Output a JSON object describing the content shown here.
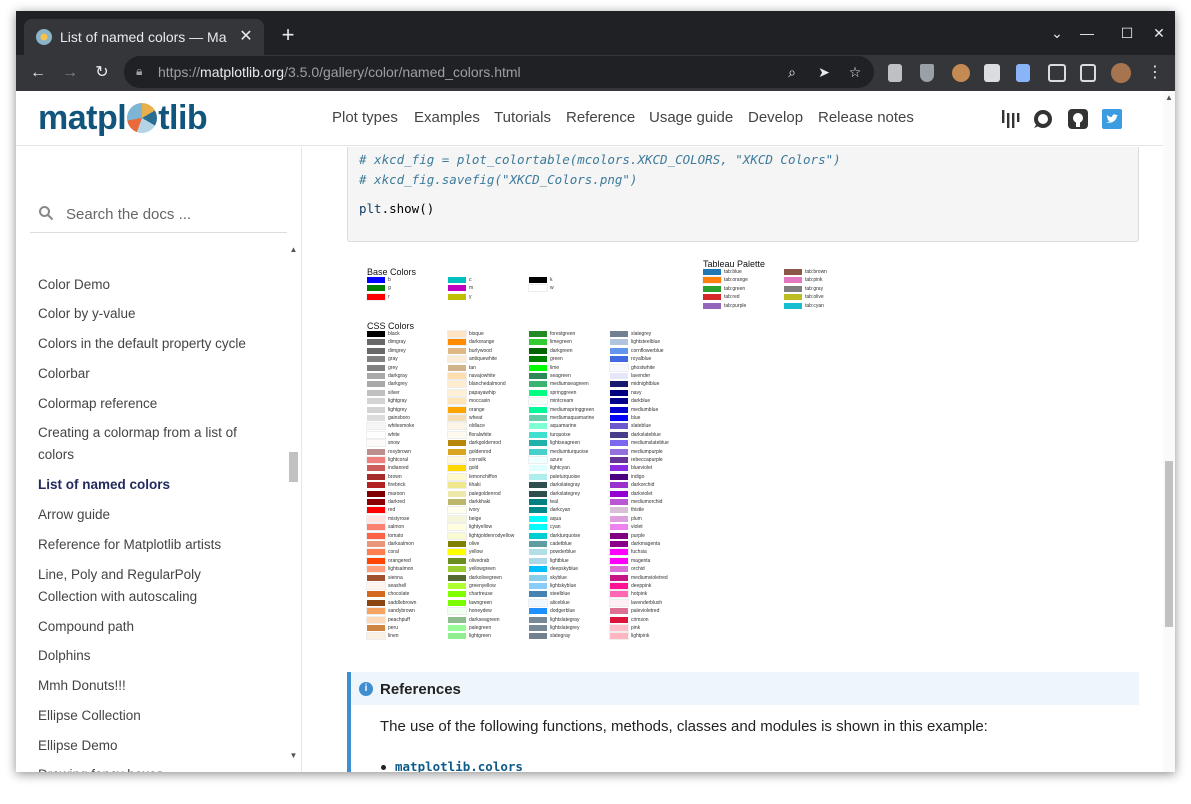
{
  "browser": {
    "tab_title": "List of named colors — Ma",
    "url_prefix": "https://",
    "url_host": "matplotlib.org",
    "url_path": "/3.5.0/gallery/color/named_colors.html"
  },
  "header": {
    "logo": "matplotlib",
    "nav": [
      "Plot types",
      "Examples",
      "Tutorials",
      "Reference",
      "Usage guide",
      "Develop",
      "Release notes"
    ]
  },
  "sidebar": {
    "search_placeholder": "Search the docs ...",
    "items": [
      {
        "label": "Color Demo"
      },
      {
        "label": "Color by y-value"
      },
      {
        "label": "Colors in the default property cycle"
      },
      {
        "label": "Colorbar"
      },
      {
        "label": "Colormap reference"
      },
      {
        "label": "Creating a colormap from a list of colors"
      },
      {
        "label": "List of named colors",
        "active": true
      },
      {
        "label": "Arrow guide"
      },
      {
        "label": "Reference for Matplotlib artists"
      },
      {
        "label": "Line, Poly and RegularPoly Collection with autoscaling"
      },
      {
        "label": "Compound path"
      },
      {
        "label": "Dolphins"
      },
      {
        "label": "Mmh Donuts!!!"
      },
      {
        "label": "Ellipse Collection"
      },
      {
        "label": "Ellipse Demo"
      },
      {
        "label": "Drawing fancy boxes"
      }
    ]
  },
  "code": {
    "line1": "# xkcd_fig = plot_colortable(mcolors.XKCD_COLORS, \"XKCD Colors\")",
    "line2": "# xkcd_fig.savefig(\"XKCD_Colors.png\")",
    "line3_obj": "plt",
    "line3_fn": ".show()"
  },
  "figure": {
    "base_title": "Base Colors",
    "tableau_title": "Tableau Palette",
    "css_title": "CSS Colors",
    "base": [
      [
        [
          "b",
          "#0000ff"
        ],
        [
          "g",
          "#008000"
        ],
        [
          "r",
          "#ff0000"
        ]
      ],
      [
        [
          "c",
          "#00bfbf"
        ],
        [
          "m",
          "#bf00bf"
        ],
        [
          "y",
          "#bfbf00"
        ]
      ],
      [
        [
          "k",
          "#000000"
        ],
        [
          "w",
          "#ffffff"
        ]
      ]
    ],
    "tableau": [
      [
        [
          "tab:blue",
          "#1f77b4"
        ],
        [
          "tab:orange",
          "#ff7f0e"
        ],
        [
          "tab:green",
          "#2ca02c"
        ],
        [
          "tab:red",
          "#d62728"
        ],
        [
          "tab:purple",
          "#9467bd"
        ]
      ],
      [
        [
          "tab:brown",
          "#8c564b"
        ],
        [
          "tab:pink",
          "#e377c2"
        ],
        [
          "tab:gray",
          "#7f7f7f"
        ],
        [
          "tab:olive",
          "#bcbd22"
        ],
        [
          "tab:cyan",
          "#17becf"
        ]
      ]
    ],
    "css": [
      [
        [
          "black",
          "#000000"
        ],
        [
          "dimgray",
          "#696969"
        ],
        [
          "dimgrey",
          "#696969"
        ],
        [
          "gray",
          "#808080"
        ],
        [
          "grey",
          "#808080"
        ],
        [
          "darkgray",
          "#a9a9a9"
        ],
        [
          "darkgrey",
          "#a9a9a9"
        ],
        [
          "silver",
          "#c0c0c0"
        ],
        [
          "lightgray",
          "#d3d3d3"
        ],
        [
          "lightgrey",
          "#d3d3d3"
        ],
        [
          "gainsboro",
          "#dcdcdc"
        ],
        [
          "whitesmoke",
          "#f5f5f5"
        ],
        [
          "white",
          "#ffffff"
        ],
        [
          "snow",
          "#fffafa"
        ],
        [
          "rosybrown",
          "#bc8f8f"
        ],
        [
          "lightcoral",
          "#f08080"
        ],
        [
          "indianred",
          "#cd5c5c"
        ],
        [
          "brown",
          "#a52a2a"
        ],
        [
          "firebrick",
          "#b22222"
        ],
        [
          "maroon",
          "#800000"
        ],
        [
          "darkred",
          "#8b0000"
        ],
        [
          "red",
          "#ff0000"
        ],
        [
          "mistyrose",
          "#ffe4e1"
        ],
        [
          "salmon",
          "#fa8072"
        ],
        [
          "tomato",
          "#ff6347"
        ],
        [
          "darksalmon",
          "#e9967a"
        ],
        [
          "coral",
          "#ff7f50"
        ],
        [
          "orangered",
          "#ff4500"
        ],
        [
          "lightsalmon",
          "#ffa07a"
        ],
        [
          "sienna",
          "#a0522d"
        ],
        [
          "seashell",
          "#fff5ee"
        ],
        [
          "chocolate",
          "#d2691e"
        ],
        [
          "saddlebrown",
          "#8b4513"
        ],
        [
          "sandybrown",
          "#f4a460"
        ],
        [
          "peachpuff",
          "#ffdab9"
        ],
        [
          "peru",
          "#cd853f"
        ],
        [
          "linen",
          "#faf0e6"
        ]
      ],
      [
        [
          "bisque",
          "#ffe4c4"
        ],
        [
          "darkorange",
          "#ff8c00"
        ],
        [
          "burlywood",
          "#deb887"
        ],
        [
          "antiquewhite",
          "#faebd7"
        ],
        [
          "tan",
          "#d2b48c"
        ],
        [
          "navajowhite",
          "#ffdead"
        ],
        [
          "blanchedalmond",
          "#ffebcd"
        ],
        [
          "papayawhip",
          "#ffefd5"
        ],
        [
          "moccasin",
          "#ffe4b5"
        ],
        [
          "orange",
          "#ffa500"
        ],
        [
          "wheat",
          "#f5deb3"
        ],
        [
          "oldlace",
          "#fdf5e6"
        ],
        [
          "floralwhite",
          "#fffaf0"
        ],
        [
          "darkgoldenrod",
          "#b8860b"
        ],
        [
          "goldenrod",
          "#daa520"
        ],
        [
          "cornsilk",
          "#fff8dc"
        ],
        [
          "gold",
          "#ffd700"
        ],
        [
          "lemonchiffon",
          "#fffacd"
        ],
        [
          "khaki",
          "#f0e68c"
        ],
        [
          "palegoldenrod",
          "#eee8aa"
        ],
        [
          "darkkhaki",
          "#bdb76b"
        ],
        [
          "ivory",
          "#fffff0"
        ],
        [
          "beige",
          "#f5f5dc"
        ],
        [
          "lightyellow",
          "#ffffe0"
        ],
        [
          "lightgoldenrodyellow",
          "#fafad2"
        ],
        [
          "olive",
          "#808000"
        ],
        [
          "yellow",
          "#ffff00"
        ],
        [
          "olivedrab",
          "#6b8e23"
        ],
        [
          "yellowgreen",
          "#9acd32"
        ],
        [
          "darkolivegreen",
          "#556b2f"
        ],
        [
          "greenyellow",
          "#adff2f"
        ],
        [
          "chartreuse",
          "#7fff00"
        ],
        [
          "lawngreen",
          "#7cfc00"
        ],
        [
          "honeydew",
          "#f0fff0"
        ],
        [
          "darkseagreen",
          "#8fbc8f"
        ],
        [
          "palegreen",
          "#98fb98"
        ],
        [
          "lightgreen",
          "#90ee90"
        ]
      ],
      [
        [
          "forestgreen",
          "#228b22"
        ],
        [
          "limegreen",
          "#32cd32"
        ],
        [
          "darkgreen",
          "#006400"
        ],
        [
          "green",
          "#008000"
        ],
        [
          "lime",
          "#00ff00"
        ],
        [
          "seagreen",
          "#2e8b57"
        ],
        [
          "mediumseagreen",
          "#3cb371"
        ],
        [
          "springgreen",
          "#00ff7f"
        ],
        [
          "mintcream",
          "#f5fffa"
        ],
        [
          "mediumspringgreen",
          "#00fa9a"
        ],
        [
          "mediumaquamarine",
          "#66cdaa"
        ],
        [
          "aquamarine",
          "#7fffd4"
        ],
        [
          "turquoise",
          "#40e0d0"
        ],
        [
          "lightseagreen",
          "#20b2aa"
        ],
        [
          "mediumturquoise",
          "#48d1cc"
        ],
        [
          "azure",
          "#f0ffff"
        ],
        [
          "lightcyan",
          "#e0ffff"
        ],
        [
          "paleturquoise",
          "#afeeee"
        ],
        [
          "darkslategray",
          "#2f4f4f"
        ],
        [
          "darkslategrey",
          "#2f4f4f"
        ],
        [
          "teal",
          "#008080"
        ],
        [
          "darkcyan",
          "#008b8b"
        ],
        [
          "aqua",
          "#00ffff"
        ],
        [
          "cyan",
          "#00ffff"
        ],
        [
          "darkturquoise",
          "#00ced1"
        ],
        [
          "cadetblue",
          "#5f9ea0"
        ],
        [
          "powderblue",
          "#b0e0e6"
        ],
        [
          "lightblue",
          "#add8e6"
        ],
        [
          "deepskyblue",
          "#00bfff"
        ],
        [
          "skyblue",
          "#87ceeb"
        ],
        [
          "lightskyblue",
          "#87cefa"
        ],
        [
          "steelblue",
          "#4682b4"
        ],
        [
          "aliceblue",
          "#f0f8ff"
        ],
        [
          "dodgerblue",
          "#1e90ff"
        ],
        [
          "lightslategray",
          "#778899"
        ],
        [
          "lightslategrey",
          "#778899"
        ],
        [
          "slategray",
          "#708090"
        ]
      ],
      [
        [
          "slategrey",
          "#708090"
        ],
        [
          "lightsteelblue",
          "#b0c4de"
        ],
        [
          "cornflowerblue",
          "#6495ed"
        ],
        [
          "royalblue",
          "#4169e1"
        ],
        [
          "ghostwhite",
          "#f8f8ff"
        ],
        [
          "lavender",
          "#e6e6fa"
        ],
        [
          "midnightblue",
          "#191970"
        ],
        [
          "navy",
          "#000080"
        ],
        [
          "darkblue",
          "#00008b"
        ],
        [
          "mediumblue",
          "#0000cd"
        ],
        [
          "blue",
          "#0000ff"
        ],
        [
          "slateblue",
          "#6a5acd"
        ],
        [
          "darkslateblue",
          "#483d8b"
        ],
        [
          "mediumslateblue",
          "#7b68ee"
        ],
        [
          "mediumpurple",
          "#9370db"
        ],
        [
          "rebeccapurple",
          "#663399"
        ],
        [
          "blueviolet",
          "#8a2be2"
        ],
        [
          "indigo",
          "#4b0082"
        ],
        [
          "darkorchid",
          "#9932cc"
        ],
        [
          "darkviolet",
          "#9400d3"
        ],
        [
          "mediumorchid",
          "#ba55d3"
        ],
        [
          "thistle",
          "#d8bfd8"
        ],
        [
          "plum",
          "#dda0dd"
        ],
        [
          "violet",
          "#ee82ee"
        ],
        [
          "purple",
          "#800080"
        ],
        [
          "darkmagenta",
          "#8b008b"
        ],
        [
          "fuchsia",
          "#ff00ff"
        ],
        [
          "magenta",
          "#ff00ff"
        ],
        [
          "orchid",
          "#da70d6"
        ],
        [
          "mediumvioletred",
          "#c71585"
        ],
        [
          "deeppink",
          "#ff1493"
        ],
        [
          "hotpink",
          "#ff69b4"
        ],
        [
          "lavenderblush",
          "#fff0f5"
        ],
        [
          "palevioletred",
          "#db7093"
        ],
        [
          "crimson",
          "#dc143c"
        ],
        [
          "pink",
          "#ffc0cb"
        ],
        [
          "lightpink",
          "#ffb6c1"
        ]
      ]
    ]
  },
  "references": {
    "title": "References",
    "description": "The use of the following functions, methods, classes and modules is shown in this example:",
    "item": "matplotlib.colors"
  }
}
